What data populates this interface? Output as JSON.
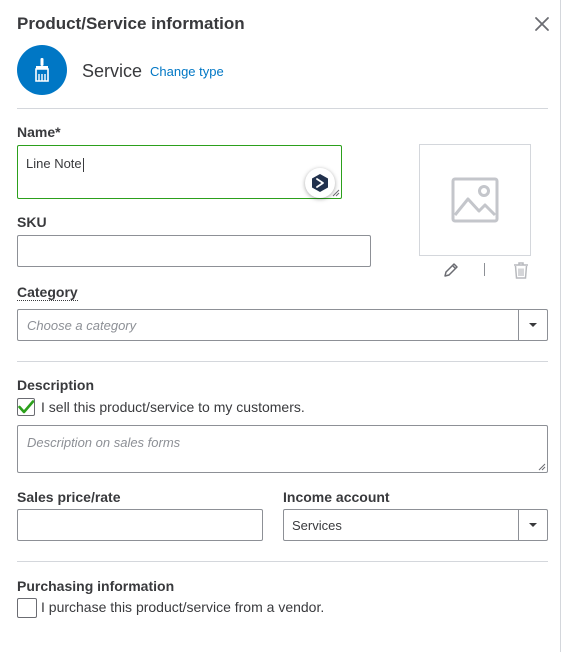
{
  "header": {
    "title": "Product/Service information",
    "type_label": "Service",
    "change_type_link": "Change type"
  },
  "form": {
    "name": {
      "label": "Name*",
      "value": "Line Note"
    },
    "sku": {
      "label": "SKU",
      "value": ""
    },
    "category": {
      "label": "Category",
      "placeholder": "Choose a category"
    },
    "description": {
      "label": "Description",
      "sell_checkbox_label": "I sell this product/service to my customers.",
      "sell_checked": true,
      "sales_description_placeholder": "Description on sales forms"
    },
    "sales_price": {
      "label": "Sales price/rate",
      "value": ""
    },
    "income_account": {
      "label": "Income account",
      "value": "Services"
    },
    "purchasing": {
      "label": "Purchasing information",
      "purchase_checkbox_label": "I purchase this product/service from a vendor.",
      "purchase_checked": false
    }
  },
  "icons": {
    "close": "close-icon",
    "type": "paintbrush-icon",
    "image_placeholder": "image-placeholder-icon",
    "edit": "pencil-icon",
    "delete": "trash-icon"
  },
  "colors": {
    "accent": "#0077c5",
    "valid_green": "#2ca01c",
    "text": "#393a3d",
    "border": "#8d9096"
  }
}
